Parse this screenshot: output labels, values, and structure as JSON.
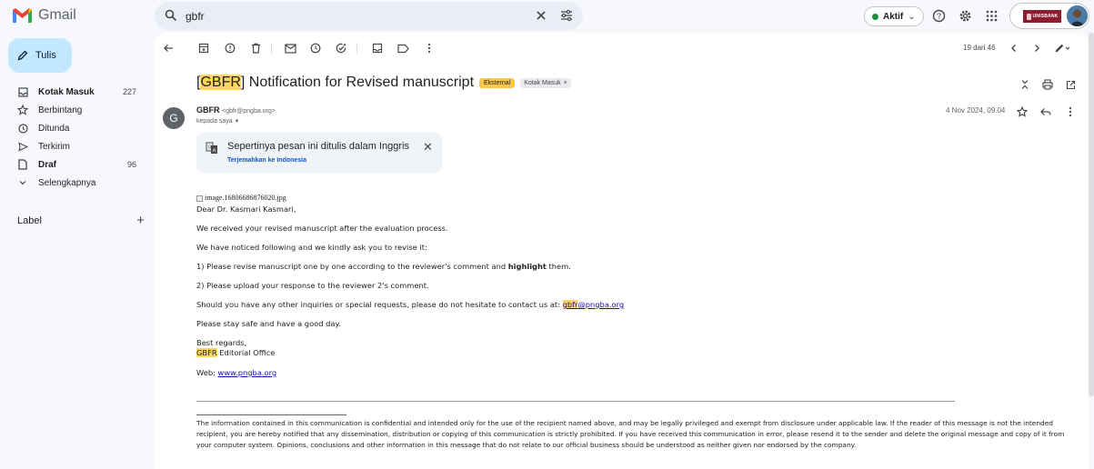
{
  "app": {
    "name": "Gmail"
  },
  "colors": {
    "accent": "#0b57d0",
    "compose_bg": "#c2e7ff",
    "highlight": "#fcd663",
    "org": "#8e1b2e",
    "status_active": "#1e8e3e"
  },
  "search": {
    "query": "gbfr",
    "icons": [
      "search-icon",
      "close-icon",
      "filter-icon"
    ]
  },
  "top": {
    "status": "Aktif",
    "org_badge": "UNISBANK",
    "icons": [
      "help-icon",
      "gear-icon",
      "apps-icon"
    ]
  },
  "sidebar": {
    "compose_label": "Tulis",
    "items": [
      {
        "label": "Kotak Masuk",
        "count": "227",
        "icon": "inbox-icon",
        "bold": true
      },
      {
        "label": "Berbintang",
        "count": "",
        "icon": "star-icon",
        "bold": false
      },
      {
        "label": "Ditunda",
        "count": "",
        "icon": "clock-icon",
        "bold": false
      },
      {
        "label": "Terkirim",
        "count": "",
        "icon": "send-icon",
        "bold": false
      },
      {
        "label": "Draf",
        "count": "96",
        "icon": "draft-icon",
        "bold": true
      },
      {
        "label": "Selengkapnya",
        "count": "",
        "icon": "chevron-down-icon",
        "bold": false
      }
    ],
    "labels_heading": "Label"
  },
  "toolbar": {
    "pager": "19 dari 46"
  },
  "email": {
    "subject_tag": "GBFR",
    "subject_rest": " Notification for Revised manuscript",
    "chip_external": "Eksternal",
    "chip_inbox": "Kotak Masuk",
    "sender_avatar": "G",
    "sender_name": "GBFR",
    "sender_addr": "<gbfr@pngba.org>",
    "recipient": "kepada saya",
    "date": "4 Nov 2024, 09.04",
    "translate": {
      "message": "Sepertinya pesan ini ditulis dalam Inggris",
      "link": "Terjemahkan ke Indonesia"
    },
    "body": {
      "image_alt": "image.16806686876020.jpg",
      "greeting": "Dear Dr. Kasmari Kasmari,",
      "p1": "We received your revised manuscript after the evaluation process.",
      "p2": "We have noticed following and we kindly ask you to revise it:",
      "p3_pre": "1) Please revise manuscript one by one according to the reviewer's comment and ",
      "p3_bold": "highlight",
      "p3_post": " them.",
      "p4": "2) Please upload your response to the reviewer 2's comment.",
      "p5_pre": "Should you have any other inquiries or special requests, please do not hesitate to contact us at: ",
      "p5_link_hl": "gbfr",
      "p5_link_rest": "@pngba.org",
      "p6": "Please stay safe and have a good day.",
      "sign1": "Best regards,",
      "sign2_hl": "GBFR",
      "sign2_rest": " Editorial Office",
      "web_label": "Web: ",
      "web_link": "www.pngba.org",
      "disclaimer": "The information contained in this communication is confidential and intended only for the use of the recipient named above, and may be legally privileged and exempt from disclosure under applicable law. If the reader of this message is not the intended recipient, you are hereby notified that any dissemination, distribution or copying of this communication is strictly prohibited. If you have received this communication in error, please resend it to the sender and delete the original message and copy of it from your computer system. Opinions, conclusions and other information in this message that do not relate to our official business should be understood as neither given nor endorsed by the company."
    }
  }
}
